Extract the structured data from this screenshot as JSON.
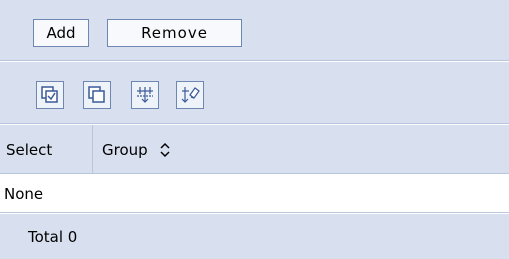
{
  "actions": {
    "add_label": "Add",
    "remove_label": "Remove"
  },
  "icon_toolbar": {
    "icons": [
      "select-all-icon",
      "deselect-all-icon",
      "expand-filter-icon",
      "clear-filter-icon"
    ]
  },
  "table": {
    "columns": [
      "Select",
      "Group"
    ],
    "empty_text": "None",
    "total_label": "Total 0"
  },
  "colors": {
    "toolbar_bg": "#d8e0f0",
    "border": "#6f86b3",
    "icon_blue": "#3a5a99"
  }
}
